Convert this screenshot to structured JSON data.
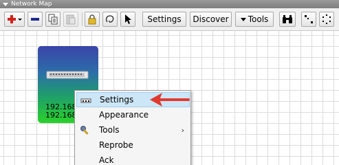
{
  "window": {
    "title": "Network Map"
  },
  "toolbar": {
    "settings_label": "Settings",
    "discover_label": "Discover",
    "tools_label": "Tools"
  },
  "device": {
    "ip_line1": "192.168",
    "ip_line2": "192.168"
  },
  "menu": {
    "items": [
      {
        "label": "Settings",
        "icon": "dots-icon"
      },
      {
        "label": "Appearance",
        "icon": ""
      },
      {
        "label": "Tools",
        "icon": "wrench-icon"
      },
      {
        "label": "Reprobe",
        "icon": ""
      },
      {
        "label": "Ack",
        "icon": ""
      }
    ]
  },
  "colors": {
    "annotation_arrow": "#e03a2f",
    "menu_highlight": "#cde6f7"
  }
}
